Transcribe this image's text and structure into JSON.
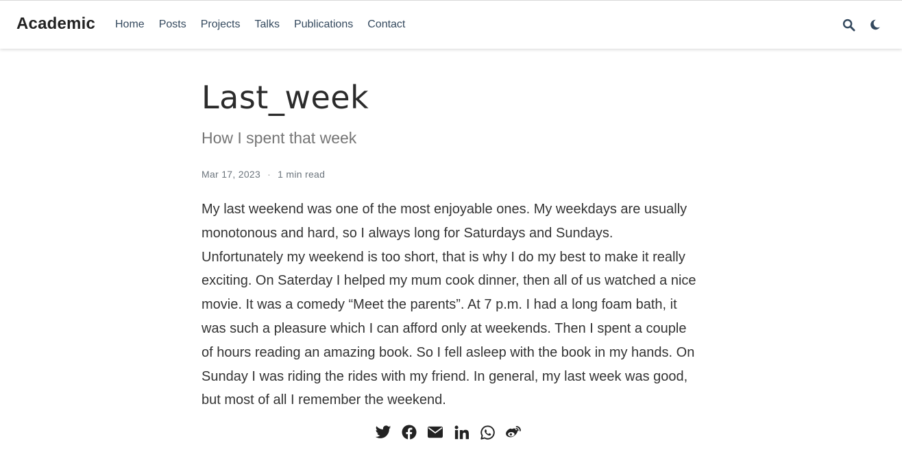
{
  "navbar": {
    "brand": "Academic",
    "menu": [
      {
        "label": "Home"
      },
      {
        "label": "Posts"
      },
      {
        "label": "Projects"
      },
      {
        "label": "Talks"
      },
      {
        "label": "Publications"
      },
      {
        "label": "Contact"
      }
    ],
    "icons": [
      "search-icon",
      "moon-icon"
    ]
  },
  "article": {
    "title": "Last_week",
    "subtitle": "How I spent that week",
    "date": "Mar 17, 2023",
    "separator": "·",
    "reading_time": "1 min read",
    "body": "My last weekend was one of the most enjoyable ones. My weekdays are usually monotonous and hard, so I always long for Saturdays and Sundays. Unfortunately my weekend is too short, that is why I do my best to make it really exciting. On Saterday I helped my mum cook dinner, then all of us watched a nice movie. It was a comedy “Meet the parents”. At 7 p.m. I had a long foam bath, it was such a pleasure which I can afford only at weekends. Then I spent a couple of hours reading an amazing book. So I fell asleep with the book in my hands. On Sunday I was riding the rides with my friend. In general, my last week was good, but most of all I remember the weekend."
  },
  "share": {
    "icons": [
      "twitter-icon",
      "facebook-icon",
      "email-icon",
      "linkedin-icon",
      "whatsapp-icon",
      "weibo-icon"
    ]
  },
  "colors": {
    "nav_text": "#34495e",
    "icon_color": "#34495e",
    "share_icon_color": "#222222",
    "subtitle": "#757575"
  }
}
